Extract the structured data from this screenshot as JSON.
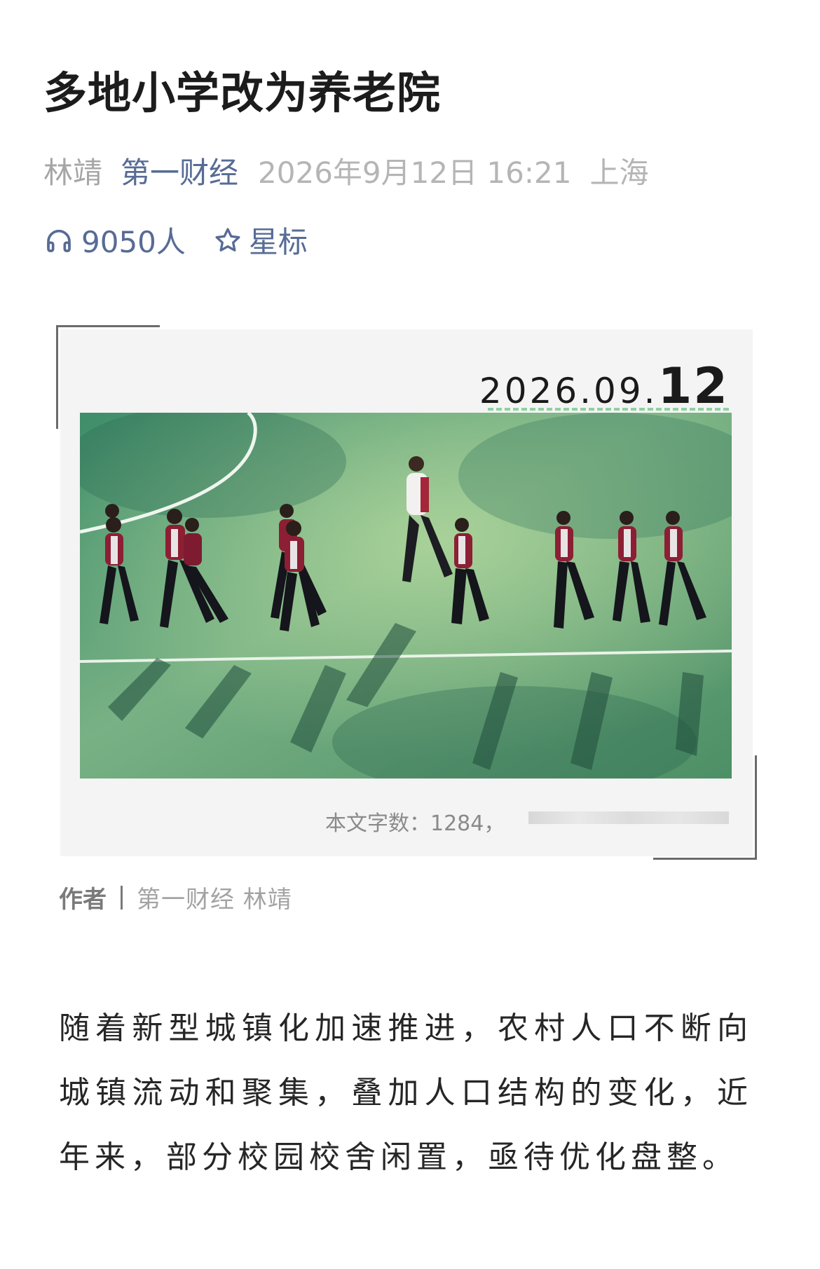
{
  "article": {
    "title": "多地小学改为养老院",
    "author": "林靖",
    "account": "第一财经",
    "datetime": "2026年9月12日 16:21",
    "location": "上海",
    "listen_count": "9050人",
    "star_label": "星标"
  },
  "cover": {
    "date_prefix": "2026.09.",
    "date_day": "12",
    "word_count": "本文字数：1284，",
    "accent_dash_color": "#8fd1a0"
  },
  "byline": {
    "label": "作者",
    "value": "第一财经  林靖"
  },
  "body": {
    "paragraph": "随着新型城镇化加速推进，农村人口不断向城镇流动和聚集，叠加人口结构的变化，近年来，部分校园校舍闲置，亟待优化盘整。"
  },
  "icons": {
    "listen": "headphones-icon",
    "star": "star-outline-icon"
  },
  "colors": {
    "link": "#576b95",
    "title": "#1c1c1c",
    "meta_gray": "#b5b5b5"
  }
}
